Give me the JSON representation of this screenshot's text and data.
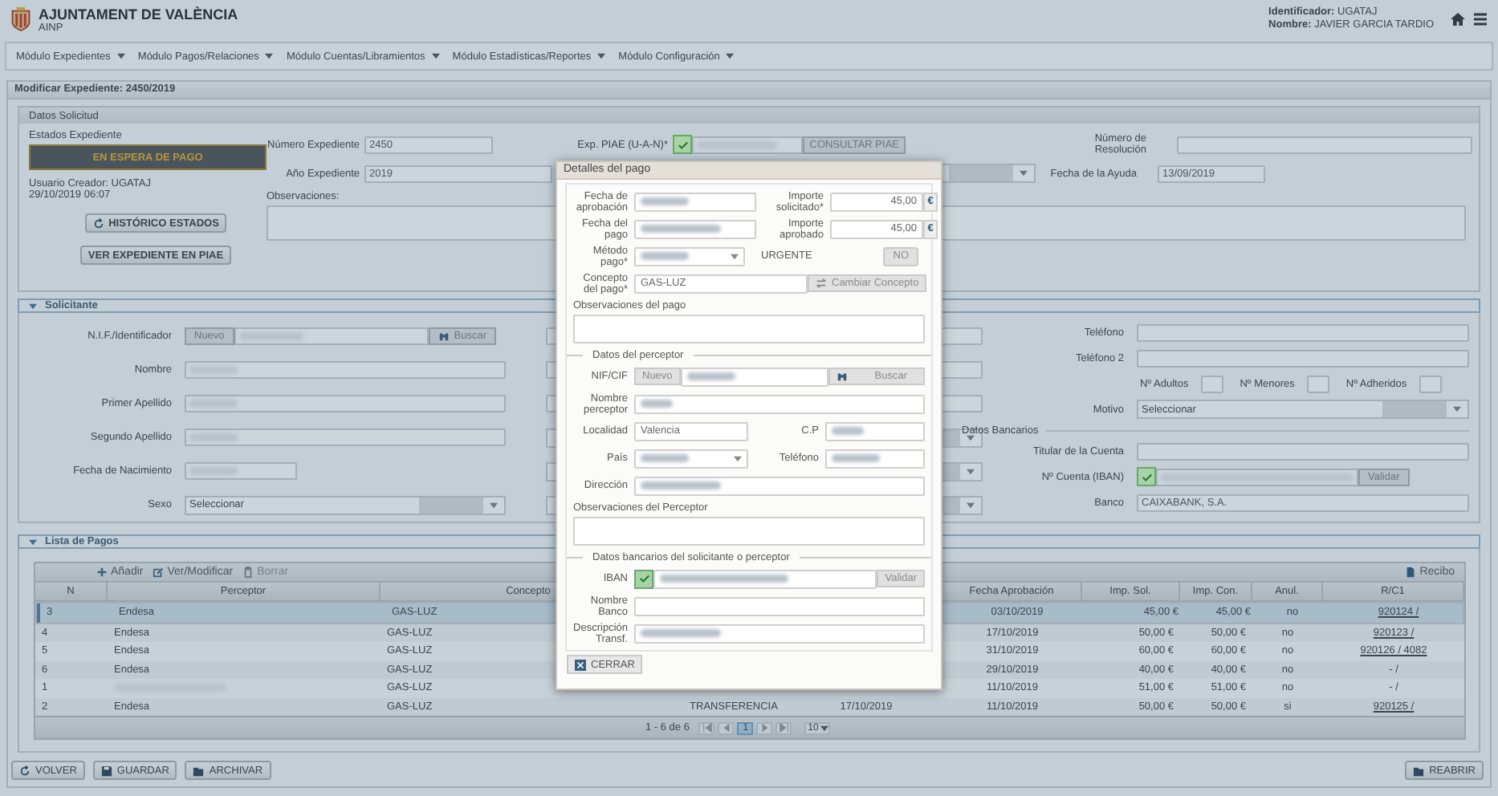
{
  "header": {
    "title": "AJUNTAMENT DE VALÈNCIA",
    "subtitle": "AINP",
    "user_id_label": "Identificador:",
    "user_id": "UGATAJ",
    "user_name_label": "Nombre:",
    "user_name": "JAVIER GARCIA TARDIO"
  },
  "menu": [
    "Módulo Expedientes",
    "Módulo Pagos/Relaciones",
    "Módulo Cuentas/Libramientos",
    "Módulo Estadísticas/Reportes",
    "Módulo Configuración"
  ],
  "page_title": "Modificar Expediente: 2450/2019",
  "datos_solicitud": {
    "title": "Datos Solicitud",
    "estado_label": "Estados Expediente",
    "estado": "EN ESPERA DE PAGO",
    "usuario": "Usuario Creador: UGATAJ",
    "fecha": "29/10/2019 06:07",
    "historico_button": "HISTÓRICO ESTADOS",
    "ver_button": "VER EXPEDIENTE EN PIAE",
    "numero_label": "Número Expediente",
    "numero": "2450",
    "anio_label": "Año Expediente",
    "anio": "2019",
    "piae_label": "Exp. PIAE (U-A-N)*",
    "piae_valid": true,
    "consultar_button": "CONSULTAR PIAE",
    "resolucion_label": "Número de Resolución",
    "fecha_ayuda_label": "Fecha de la Ayuda",
    "fecha_ayuda": "13/09/2019",
    "observaciones_label": "Observaciones:"
  },
  "solicitante": {
    "title": "Solicitante",
    "nif_label": "N.I.F./Identificador",
    "nuevo_button": "Nuevo",
    "buscar_button": "Buscar",
    "nombre_label": "Nombre",
    "primer_apellido_label": "Primer Apellido",
    "segundo_apellido_label": "Segundo Apellido",
    "fecha_nacimiento_label": "Fecha de Nacimiento",
    "sexo_label": "Sexo",
    "sexo_placeholder": "Seleccionar",
    "telefono_label": "Teléfono",
    "telefono2_label": "Teléfono 2",
    "adultos_label": "Nº Adultos",
    "menores_label": "Nº Menores",
    "adheridos_label": "Nº Adheridos",
    "motivo_label": "Motivo",
    "motivo_placeholder": "Seleccionar",
    "bancarios_legend": "Datos Bancarios",
    "titular_label": "Titular de la Cuenta",
    "iban_label": "Nº Cuenta (IBAN)",
    "iban_valid": true,
    "validar_button": "Validar",
    "banco_label": "Banco",
    "banco": "CAIXABANK, S.A."
  },
  "lista_pagos": {
    "title": "Lista de Pagos",
    "toolbar": [
      {
        "kind": "add",
        "label": "Añadir"
      },
      {
        "kind": "edit",
        "label": "Ver/Modificar"
      },
      {
        "kind": "delete",
        "label": "Borrar"
      }
    ],
    "recibo_button": "Recibo",
    "columns": [
      "N",
      "Perceptor",
      "Concepto",
      "Fecha Aprobación",
      "Imp. Sol.",
      "Imp. Con.",
      "Anul.",
      "R/C1"
    ],
    "rows": [
      {
        "n": "3",
        "perceptor": "Endesa",
        "perceptor_blurred": false,
        "concepto": "GAS-LUZ",
        "fecha_aprobacion": "03/10/2019",
        "imp_sol": "45,00 €",
        "imp_con": "45,00 €",
        "anul": "no",
        "rc1": "920124 /",
        "rc1_linked": true,
        "selected": true
      },
      {
        "n": "4",
        "perceptor": "Endesa",
        "perceptor_blurred": false,
        "concepto": "GAS-LUZ",
        "fecha_aprobacion": "17/10/2019",
        "imp_sol": "50,00 €",
        "imp_con": "50,00 €",
        "anul": "no",
        "rc1": "920123 /",
        "rc1_linked": true,
        "selected": false
      },
      {
        "n": "5",
        "perceptor": "Endesa",
        "perceptor_blurred": false,
        "concepto": "GAS-LUZ",
        "fecha_aprobacion": "31/10/2019",
        "imp_sol": "60,00 €",
        "imp_con": "60,00 €",
        "anul": "no",
        "rc1": "920126 / 4082",
        "rc1_linked": true,
        "selected": false
      },
      {
        "n": "6",
        "perceptor": "Endesa",
        "perceptor_blurred": false,
        "concepto": "GAS-LUZ",
        "fecha_aprobacion": "29/10/2019",
        "imp_sol": "40,00 €",
        "imp_con": "40,00 €",
        "anul": "no",
        "rc1": "- /",
        "rc1_linked": false,
        "selected": false
      },
      {
        "n": "1",
        "perceptor_blurred": true,
        "concepto": "GAS-LUZ",
        "fecha_aprobacion": "11/10/2019",
        "imp_sol": "51,00 €",
        "imp_con": "51,00 €",
        "anul": "no",
        "rc1": "- /",
        "rc1_linked": false,
        "selected": false
      },
      {
        "n": "2",
        "perceptor": "Endesa",
        "perceptor_blurred": false,
        "concepto": "GAS-LUZ",
        "column_4": "TRANSFERENCIA",
        "column_5": "17/10/2019",
        "fecha_aprobacion": "11/10/2019",
        "imp_sol": "50,00 €",
        "imp_con": "50,00 €",
        "anul": "si",
        "rc1": "920125 /",
        "rc1_linked": true,
        "selected": false
      }
    ],
    "pager": {
      "summary": "1 - 6 de 6",
      "page": "1",
      "page_size": "10"
    }
  },
  "buttons": {
    "volver": "VOLVER",
    "guardar": "GUARDAR",
    "archivar": "ARCHIVAR",
    "reabrir": "REABRIR"
  },
  "detalle_pago": {
    "title": "Detalles del pago",
    "fecha_aprobacion_label": "Fecha de aprobación",
    "importe_solicitado_label": "Importe solicitado*",
    "importe_solicitado": "45,00",
    "currency_solicitado": "€",
    "fecha_pago_label": "Fecha del pago",
    "importe_aprobado_label": "Importe aprobado",
    "importe_aprobado": "45,00",
    "currency_aprobado": "€",
    "metodo_label": "Método pago*",
    "urgente_label": "URGENTE",
    "urgente": "NO",
    "concepto_label": "Concepto del pago*",
    "concepto": "GAS-LUZ",
    "cambiar_button": "Cambiar Concepto",
    "observaciones_pago_label": "Observaciones del pago",
    "perceptor_legend": "Datos del perceptor",
    "nif_label": "NIF/CIF",
    "nuevo_button": "Nuevo",
    "buscar_button": "Buscar",
    "nombre_label": "Nombre perceptor",
    "localidad_label": "Localidad",
    "localidad": "Valencia",
    "cp_label": "C.P",
    "pais_label": "País",
    "telefono_label": "Teléfono",
    "direccion_label": "Dirección",
    "observaciones_perceptor_label": "Observaciones del Perceptor",
    "bancarios_legend": "Datos bancarios del solicitante o perceptor",
    "iban_label": "IBAN",
    "iban_valid": true,
    "validar_button": "Validar",
    "nombre_banco_label": "Nombre Banco",
    "descripcion_label": "Descripción Transf.",
    "cerrar_button": "CERRAR"
  }
}
